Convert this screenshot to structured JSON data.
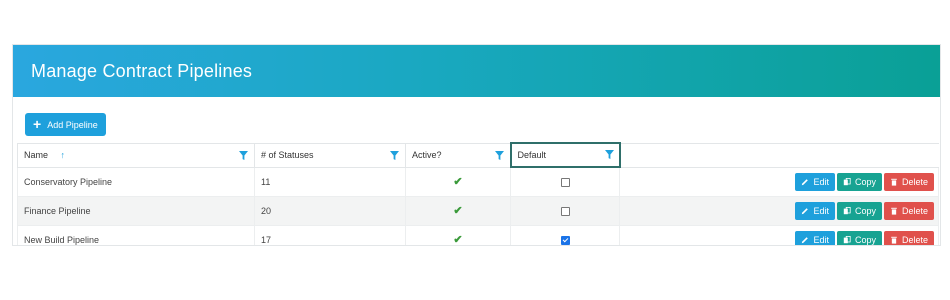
{
  "page": {
    "title": "Manage Contract Pipelines"
  },
  "toolbar": {
    "add_label": "Add Pipeline"
  },
  "table": {
    "columns": [
      {
        "label": "Name",
        "sorted": "ascending"
      },
      {
        "label": "# of Statuses"
      },
      {
        "label": "Active?"
      },
      {
        "label": "Default"
      }
    ],
    "rows": [
      {
        "name": "Conservatory Pipeline",
        "statuses": "11",
        "active": true,
        "default": false
      },
      {
        "name": "Finance Pipeline",
        "statuses": "20",
        "active": true,
        "default": false
      },
      {
        "name": "New Build Pipeline",
        "statuses": "17",
        "active": true,
        "default": true
      }
    ],
    "actions": {
      "edit": "Edit",
      "copy": "Copy",
      "delete": "Delete"
    }
  },
  "colors": {
    "header_start": "#2aa7df",
    "header_end": "#0aa096",
    "primary": "#1ea0dc",
    "copy": "#17a392",
    "delete": "#e0514c",
    "check": "#3a9a3a"
  },
  "icons": {
    "add": "plus-icon",
    "sort": "sort-up-arrow-icon",
    "filter": "filter-icon",
    "active": "checkmark-icon",
    "edit": "pencil-icon",
    "copy": "copy-icon",
    "delete": "trash-icon"
  }
}
